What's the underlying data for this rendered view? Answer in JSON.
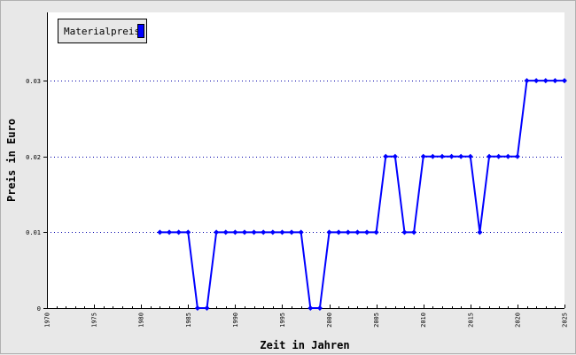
{
  "chart_data": {
    "type": "line",
    "xlabel": "Zeit in Jahren",
    "ylabel": "Preis in Euro",
    "xlim": [
      1970,
      2025
    ],
    "ylim": [
      0,
      0.039
    ],
    "x_ticks": [
      "1970",
      "1975",
      "1980",
      "1985",
      "1990",
      "1995",
      "2000",
      "2005",
      "2010",
      "2015",
      "2020",
      "2025"
    ],
    "y_ticks": [
      "0",
      "0.01",
      "0.02",
      "0.03"
    ],
    "grid": "horizontal dotted",
    "legend_position": "top-left",
    "series": [
      {
        "name": "Materialpreis",
        "color": "#0000ff",
        "x": [
          1982,
          1983,
          1984,
          1985,
          1986,
          1987,
          1988,
          1989,
          1990,
          1991,
          1992,
          1993,
          1994,
          1995,
          1996,
          1997,
          1998,
          1999,
          2000,
          2001,
          2002,
          2003,
          2004,
          2005,
          2006,
          2007,
          2008,
          2009,
          2010,
          2011,
          2012,
          2013,
          2014,
          2015,
          2016,
          2017,
          2018,
          2019,
          2020,
          2021,
          2022,
          2023,
          2024,
          2025
        ],
        "values": [
          0.01,
          0.01,
          0.01,
          0.01,
          0,
          0,
          0.01,
          0.01,
          0.01,
          0.01,
          0.01,
          0.01,
          0.01,
          0.01,
          0.01,
          0.01,
          0,
          0,
          0.01,
          0.01,
          0.01,
          0.01,
          0.01,
          0.01,
          0.02,
          0.02,
          0.01,
          0.01,
          0.02,
          0.02,
          0.02,
          0.02,
          0.02,
          0.02,
          0.01,
          0.02,
          0.02,
          0.02,
          0.02,
          0.03,
          0.03,
          0.03,
          0.03,
          0.03
        ]
      }
    ]
  }
}
